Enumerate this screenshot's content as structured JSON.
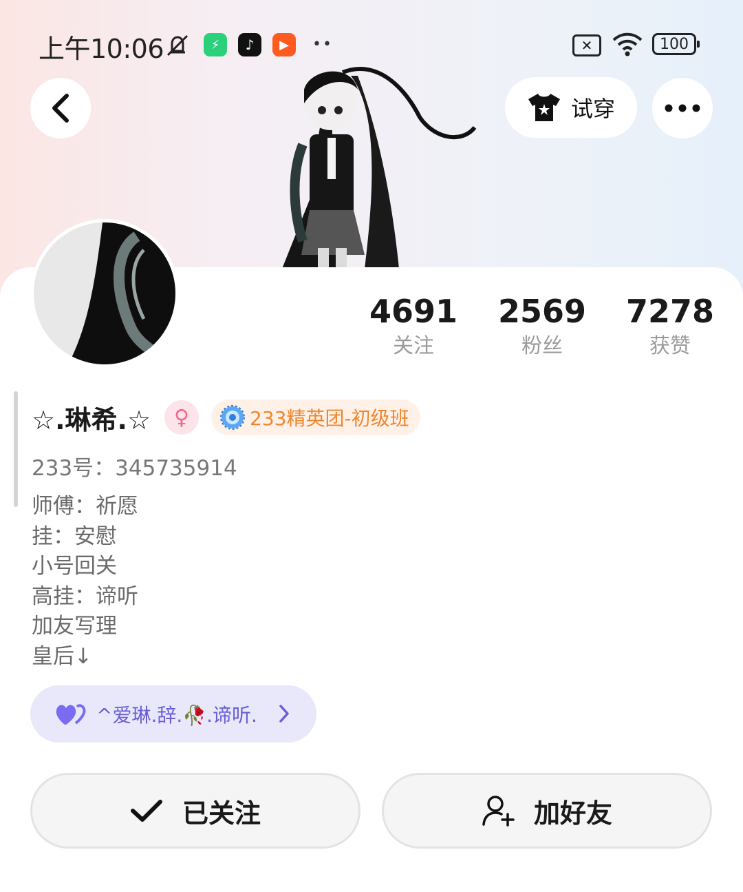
{
  "status_bar": {
    "time": "上午10:06",
    "battery": "100",
    "icons": [
      "mute-icon",
      "shield-app-icon",
      "tiktok-app-icon",
      "video-app-icon",
      "more-dots-icon",
      "no-sim-icon",
      "wifi-icon",
      "battery-icon"
    ]
  },
  "header": {
    "back_icon": "chevron-left-icon",
    "try_on_label": "试穿",
    "try_on_icon": "tshirt-icon",
    "more_icon": "ellipsis-icon"
  },
  "profile": {
    "name": "☆.琳希.☆",
    "gender_icon": "female-icon",
    "rank_label": "233精英团-初级班",
    "id_text": "233号：345735914",
    "bio_lines": [
      "师傅：祈愿",
      "挂：安慰",
      "小号回关",
      "高挂：谛听",
      "加友写理",
      "皇后↓"
    ]
  },
  "stats": [
    {
      "value": "4691",
      "label": "关注"
    },
    {
      "value": "2569",
      "label": "粉丝"
    },
    {
      "value": "7278",
      "label": "获赞"
    }
  ],
  "relation": {
    "icon": "double-heart-icon",
    "label": "^爱琳.辞.🥀.谛听."
  },
  "actions": {
    "follow_label": "已关注",
    "add_friend_label": "加好友"
  },
  "colors": {
    "accent_orange": "#f0862c",
    "relation_purple": "#6a5fd4",
    "gender_pink": "#f2668a"
  }
}
